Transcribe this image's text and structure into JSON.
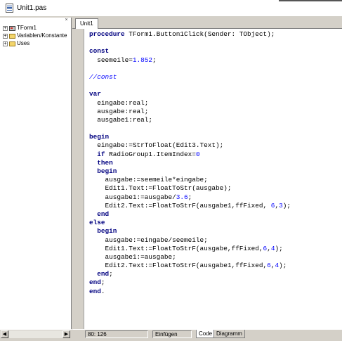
{
  "window": {
    "title": "Unit1.pas"
  },
  "tree": {
    "items": [
      {
        "label": "TForm1",
        "icon": "form-icon"
      },
      {
        "label": "Variablen/Konstante",
        "icon": "folder-icon"
      },
      {
        "label": "Uses",
        "icon": "folder-icon"
      }
    ],
    "expander": "+",
    "close_glyph": "×"
  },
  "tabs": [
    {
      "label": "Unit1"
    }
  ],
  "code": {
    "lines": [
      [
        [
          "kw",
          "procedure "
        ],
        [
          "ident",
          "TForm1.Button1Click(Sender: TObject);"
        ]
      ],
      [],
      [
        [
          "kw",
          "const"
        ]
      ],
      [
        [
          "ident",
          "  seemeile="
        ],
        [
          "num",
          "1.852"
        ],
        [
          "ident",
          ";"
        ]
      ],
      [],
      [
        [
          "cmt",
          "//const"
        ]
      ],
      [],
      [
        [
          "kw",
          "var"
        ]
      ],
      [
        [
          "ident",
          "  eingabe:real;"
        ]
      ],
      [
        [
          "ident",
          "  ausgabe:real;"
        ]
      ],
      [
        [
          "ident",
          "  ausgabe1:real;"
        ]
      ],
      [],
      [
        [
          "kw",
          "begin"
        ]
      ],
      [
        [
          "ident",
          "  eingabe:=StrToFloat(Edit3.Text);"
        ]
      ],
      [
        [
          "ident",
          "  "
        ],
        [
          "kw",
          "if "
        ],
        [
          "ident",
          "RadioGroup1.ItemIndex="
        ],
        [
          "num",
          "0"
        ]
      ],
      [
        [
          "ident",
          "  "
        ],
        [
          "kw",
          "then"
        ]
      ],
      [
        [
          "ident",
          "  "
        ],
        [
          "kw",
          "begin"
        ]
      ],
      [
        [
          "ident",
          "    ausgabe:=seemeile*eingabe;"
        ]
      ],
      [
        [
          "ident",
          "    Edit1.Text:=FloatToStr(ausgabe);"
        ]
      ],
      [
        [
          "ident",
          "    ausgabe1:=ausgabe/"
        ],
        [
          "num",
          "3.6"
        ],
        [
          "ident",
          ";"
        ]
      ],
      [
        [
          "ident",
          "    Edit2.Text:=FloatToStrF(ausgabe1,ffFixed, "
        ],
        [
          "num",
          "6"
        ],
        [
          "ident",
          ","
        ],
        [
          "num",
          "3"
        ],
        [
          "ident",
          ");"
        ]
      ],
      [
        [
          "ident",
          "  "
        ],
        [
          "kw",
          "end"
        ]
      ],
      [
        [
          "kw",
          "else"
        ]
      ],
      [
        [
          "ident",
          "  "
        ],
        [
          "kw",
          "begin"
        ]
      ],
      [
        [
          "ident",
          "    ausgabe:=eingabe/seemeile;"
        ]
      ],
      [
        [
          "ident",
          "    Edit1.Text:=FloatToStrF(ausgabe,ffFixed,"
        ],
        [
          "num",
          "6"
        ],
        [
          "ident",
          ","
        ],
        [
          "num",
          "4"
        ],
        [
          "ident",
          ");"
        ]
      ],
      [
        [
          "ident",
          "    ausgabe1:=ausgabe;"
        ]
      ],
      [
        [
          "ident",
          "    Edit2.Text:=FloatToStrF(ausgabe1,ffFixed,"
        ],
        [
          "num",
          "6"
        ],
        [
          "ident",
          ","
        ],
        [
          "num",
          "4"
        ],
        [
          "ident",
          ");"
        ]
      ],
      [
        [
          "ident",
          "  "
        ],
        [
          "kw",
          "end"
        ],
        [
          "ident",
          ";"
        ]
      ],
      [
        [
          "kw",
          "end"
        ],
        [
          "ident",
          ";"
        ]
      ],
      [
        [
          "kw",
          "end"
        ],
        [
          "ident",
          "."
        ]
      ]
    ]
  },
  "statusbar": {
    "position": "80: 126",
    "mode": "Einfügen",
    "view_tabs": [
      "Code",
      "Diagramm"
    ]
  },
  "scrollbar": {
    "left_arrow": "◀",
    "right_arrow": "▶"
  },
  "colors": {
    "keyword": "#000080",
    "number": "#0000ff",
    "comment": "#0000ff"
  }
}
